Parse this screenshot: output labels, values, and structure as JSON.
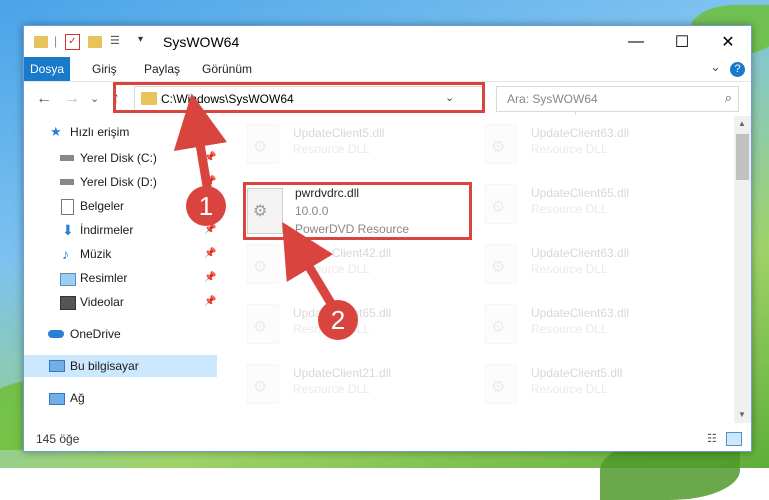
{
  "window": {
    "title": "SysWOW64",
    "minimize_icon": "—",
    "maximize_icon": "☐",
    "close_icon": "✕"
  },
  "ribbon": {
    "tabs": [
      {
        "label": "Dosya",
        "active": true
      },
      {
        "label": "Giriş"
      },
      {
        "label": "Paylaş"
      },
      {
        "label": "Görünüm"
      }
    ],
    "expand_icon": "⌄",
    "help_icon": "?"
  },
  "nav": {
    "back_icon": "←",
    "forward_icon": "→",
    "recent_icon": "⌄",
    "up_icon": "↑",
    "address": "C:\\Windows\\SysWOW64",
    "address_dropdown": "⌄",
    "refresh_icon": "↻",
    "search_placeholder": "Ara: SysWOW64",
    "search_icon": "⌕"
  },
  "sidebar": {
    "items": [
      {
        "label": "Hızlı erişim",
        "icon": "star-icon"
      },
      {
        "label": "Yerel Disk (C:)",
        "icon": "drive-icon",
        "pinned": true
      },
      {
        "label": "Yerel Disk (D:)",
        "icon": "drive-icon",
        "pinned": true
      },
      {
        "label": "Belgeler",
        "icon": "documents-icon",
        "pinned": true
      },
      {
        "label": "İndirmeler",
        "icon": "download-icon",
        "pinned": true
      },
      {
        "label": "Müzik",
        "icon": "music-icon",
        "pinned": true
      },
      {
        "label": "Resimler",
        "icon": "pictures-icon",
        "pinned": true
      },
      {
        "label": "Videolar",
        "icon": "videos-icon",
        "pinned": true
      },
      {
        "label": "OneDrive",
        "icon": "cloud-icon"
      },
      {
        "label": "Bu bilgisayar",
        "icon": "computer-icon",
        "selected": true
      },
      {
        "label": "Ağ",
        "icon": "network-icon"
      }
    ],
    "pin_glyph": "📌"
  },
  "files": {
    "highlighted": {
      "name": "pwrdvdrc.dll",
      "version": "10.0.0",
      "description": "PowerDVD Resource"
    },
    "background": [
      {
        "name": "UpdateClient5.dll",
        "desc": "Resource DLL"
      },
      {
        "name": "UpdateClient63.dll",
        "desc": "Resource DLL"
      },
      {
        "name": "UpdateClient65.dll",
        "desc": "Resource DLL"
      },
      {
        "name": "UpdateClient42.dll",
        "desc": "Resource DLL"
      },
      {
        "name": "UpdateClient63.dll",
        "desc": "Resource DLL"
      },
      {
        "name": "UpdateClient65.dll",
        "desc": "Resource DLL"
      },
      {
        "name": "UpdateClient63.dll",
        "desc": "Resource DLL"
      },
      {
        "name": "UpdateClient21.dll",
        "desc": "Resource DLL"
      },
      {
        "name": "UpdateClient5.dll",
        "desc": "Resource DLL"
      }
    ]
  },
  "status": {
    "item_count": "145 öğe"
  },
  "callouts": [
    "1",
    "2"
  ],
  "colors": {
    "accent": "#1979ca",
    "highlight_box": "#d9443f",
    "selected_nav": "#cce8ff"
  }
}
